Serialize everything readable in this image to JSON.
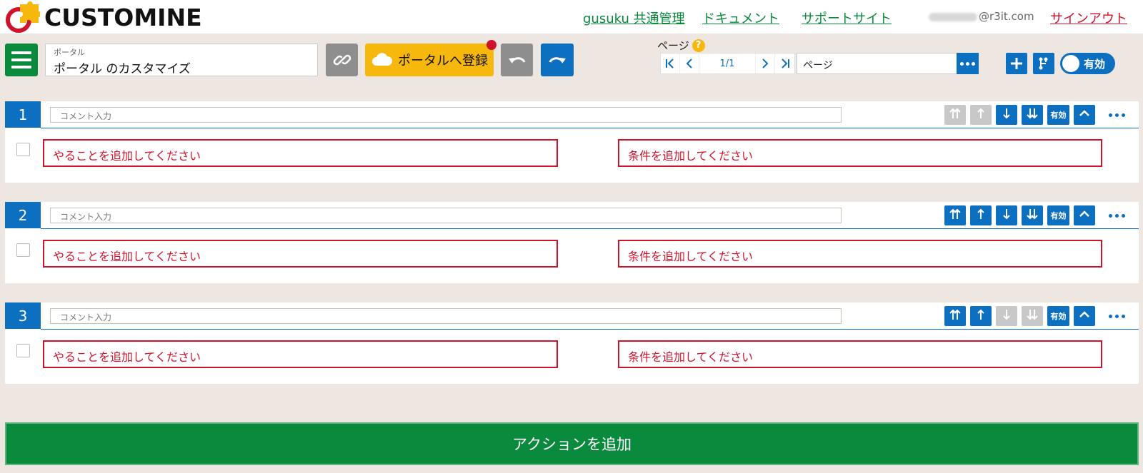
{
  "header": {
    "logo_text": "CUSTOMINE",
    "nav": [
      "gusuku 共通管理",
      "ドキュメント",
      "サポートサイト"
    ],
    "user_email": "@r3it.com",
    "signout": "サインアウト"
  },
  "toolbar": {
    "portal_label": "ポータル",
    "portal_value": "ポータル のカスタマイズ",
    "register_label": "ポータルへ登録"
  },
  "page_nav": {
    "label": "ページ",
    "help": "?",
    "page_number": "1/1",
    "page_select_value": "ページ",
    "toggle_label": "有効"
  },
  "actions": [
    {
      "number": "1",
      "comment_placeholder": "コメント入力",
      "enable_label": "有効",
      "todo": "やることを追加してください",
      "condition": "条件を追加してください",
      "move_top_enabled": false,
      "move_up_enabled": false,
      "move_down_enabled": true,
      "move_bottom_enabled": true
    },
    {
      "number": "2",
      "comment_placeholder": "コメント入力",
      "enable_label": "有効",
      "todo": "やることを追加してください",
      "condition": "条件を追加してください",
      "move_top_enabled": true,
      "move_up_enabled": true,
      "move_down_enabled": true,
      "move_bottom_enabled": true
    },
    {
      "number": "3",
      "comment_placeholder": "コメント入力",
      "enable_label": "有効",
      "todo": "やることを追加してください",
      "condition": "条件を追加してください",
      "move_top_enabled": true,
      "move_up_enabled": true,
      "move_down_enabled": false,
      "move_bottom_enabled": false
    }
  ],
  "add_action_label": "アクションを追加",
  "colors": {
    "brand_green": "#0a8a3c",
    "accent_blue": "#0d6fbf",
    "warning_red": "#d0122b",
    "register_yellow": "#f7b80e",
    "background": "#eee6e1"
  }
}
